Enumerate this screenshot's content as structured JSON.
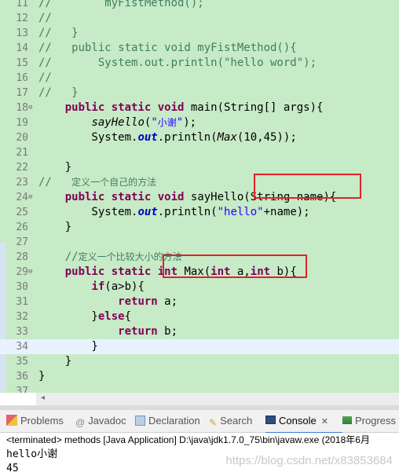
{
  "editor": {
    "lines": [
      {
        "n": "11",
        "parts": [
          [
            "cm",
            "//        myFistMethod();"
          ]
        ]
      },
      {
        "n": "12",
        "parts": [
          [
            "cm",
            "//"
          ]
        ]
      },
      {
        "n": "13",
        "parts": [
          [
            "cm",
            "//   }"
          ]
        ]
      },
      {
        "n": "14",
        "parts": [
          [
            "cm",
            "//   public static void myFistMethod(){"
          ]
        ]
      },
      {
        "n": "15",
        "parts": [
          [
            "cm",
            "//       System.out.println(\"hello word\");"
          ]
        ]
      },
      {
        "n": "16",
        "parts": [
          [
            "cm",
            "//"
          ]
        ]
      },
      {
        "n": "17",
        "parts": [
          [
            "cm",
            "//   }"
          ]
        ]
      },
      {
        "n": "18",
        "fold": true,
        "parts": [
          [
            "",
            "    "
          ],
          [
            "kw",
            "public static void"
          ],
          [
            "",
            " main(String[] args){"
          ]
        ]
      },
      {
        "n": "19",
        "parts": [
          [
            "",
            "        "
          ],
          [
            "it",
            "sayHello"
          ],
          [
            "",
            "("
          ],
          [
            "st",
            "\""
          ],
          [
            "st cn",
            "小谢"
          ],
          [
            "st",
            "\""
          ],
          [
            "",
            ");"
          ]
        ]
      },
      {
        "n": "20",
        "parts": [
          [
            "",
            "        System."
          ],
          [
            "field",
            "out"
          ],
          [
            "",
            ".println("
          ],
          [
            "it",
            "Max"
          ],
          [
            "",
            "(10,45));"
          ]
        ]
      },
      {
        "n": "21",
        "parts": [
          [
            "",
            ""
          ]
        ]
      },
      {
        "n": "22",
        "parts": [
          [
            "",
            "    }"
          ]
        ]
      },
      {
        "n": "23",
        "parts": [
          [
            "cm",
            "//   "
          ],
          [
            "cm cn",
            "定义一个自己的方法"
          ]
        ]
      },
      {
        "n": "24",
        "fold": true,
        "parts": [
          [
            "",
            "    "
          ],
          [
            "kw",
            "public static void"
          ],
          [
            "",
            " sayHello(String name){"
          ]
        ]
      },
      {
        "n": "25",
        "parts": [
          [
            "",
            "        System."
          ],
          [
            "field",
            "out"
          ],
          [
            "",
            ".println("
          ],
          [
            "st",
            "\"hello\""
          ],
          [
            "",
            "+name);"
          ]
        ]
      },
      {
        "n": "26",
        "parts": [
          [
            "",
            "    }"
          ]
        ]
      },
      {
        "n": "27",
        "parts": [
          [
            "",
            ""
          ]
        ]
      },
      {
        "n": "28",
        "parts": [
          [
            "",
            "    "
          ],
          [
            "cm",
            "//"
          ],
          [
            "cm cn",
            "定义一个比较大小的方法"
          ]
        ]
      },
      {
        "n": "29",
        "fold": true,
        "parts": [
          [
            "",
            "    "
          ],
          [
            "kw",
            "public static int"
          ],
          [
            "",
            " Max("
          ],
          [
            "kw",
            "int"
          ],
          [
            "",
            " a,"
          ],
          [
            "kw",
            "int"
          ],
          [
            "",
            " b){"
          ]
        ]
      },
      {
        "n": "30",
        "parts": [
          [
            "",
            "        "
          ],
          [
            "kw",
            "if"
          ],
          [
            "",
            "(a>b){"
          ]
        ]
      },
      {
        "n": "31",
        "parts": [
          [
            "",
            "            "
          ],
          [
            "kw",
            "return"
          ],
          [
            "",
            " a;"
          ]
        ]
      },
      {
        "n": "32",
        "parts": [
          [
            "",
            "        }"
          ],
          [
            "kw",
            "else"
          ],
          [
            "",
            "{"
          ]
        ]
      },
      {
        "n": "33",
        "parts": [
          [
            "",
            "            "
          ],
          [
            "kw",
            "return"
          ],
          [
            "",
            " b;"
          ]
        ]
      },
      {
        "n": "34",
        "current": true,
        "parts": [
          [
            "",
            "        }"
          ]
        ]
      },
      {
        "n": "35",
        "parts": [
          [
            "",
            "    }"
          ]
        ]
      },
      {
        "n": "36",
        "parts": [
          [
            "",
            "}"
          ]
        ]
      },
      {
        "n": "37",
        "parts": [
          [
            "",
            ""
          ]
        ]
      }
    ]
  },
  "panel": {
    "tabs": [
      {
        "label": "Problems",
        "icon": "problems-icon"
      },
      {
        "label": "Javadoc",
        "icon": "javadoc-icon"
      },
      {
        "label": "Declaration",
        "icon": "declaration-icon"
      },
      {
        "label": "Search",
        "icon": "search-icon"
      },
      {
        "label": "Console",
        "icon": "console-icon",
        "active": true,
        "close": "✕"
      },
      {
        "label": "Progress",
        "icon": "progress-icon"
      }
    ],
    "status": "<terminated> methods [Java Application] D:\\java\\jdk1.7.0_75\\bin\\javaw.exe (2018年6月",
    "output": [
      "hello小谢",
      "45"
    ],
    "watermark": "https://blog.csdn.net/x83853684"
  },
  "colors": {
    "editor_bg": "#c7eac7",
    "keyword": "#7f0055",
    "comment": "#3f7f5f",
    "string": "#2a00ff",
    "field": "#0000c0",
    "highlight_box": "#e0232a"
  }
}
